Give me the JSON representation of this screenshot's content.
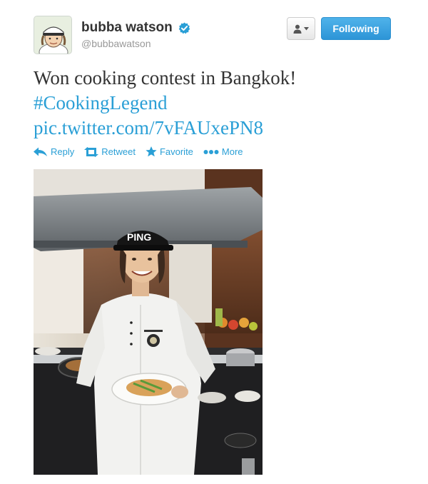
{
  "user": {
    "full_name": "bubba watson",
    "handle": "@bubbawatson",
    "verified_icon": "verified-badge-icon",
    "avatar_icon": "avatar-illustration"
  },
  "buttons": {
    "user_menu_icon": "person-icon",
    "follow_label": "Following"
  },
  "tweet": {
    "text": "Won cooking contest in Bangkok!",
    "hashtag": "#CookingLegend",
    "link": "pic.twitter.com/7vFAUxePN8"
  },
  "actions": [
    {
      "label": "Reply",
      "icon": "reply-icon"
    },
    {
      "label": "Retweet",
      "icon": "retweet-icon"
    },
    {
      "label": "Favorite",
      "icon": "star-icon"
    },
    {
      "label": "More",
      "icon": "ellipsis-icon"
    }
  ],
  "photo": {
    "cap_text": "PING"
  },
  "colors": {
    "link": "#2a9fd6",
    "follow_button": "#2d95d7",
    "verified": "#2a9fd6"
  }
}
